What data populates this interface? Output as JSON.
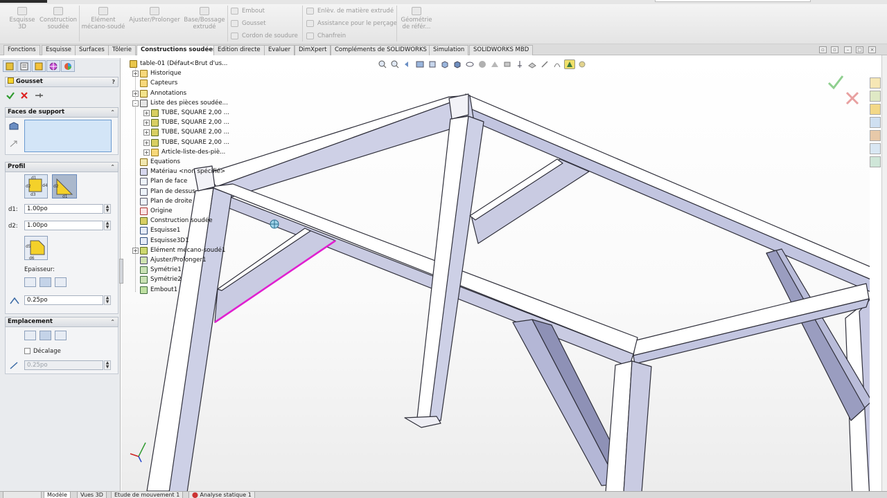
{
  "ribbon": {
    "buttons": [
      {
        "label": "Esquisse\n3D"
      },
      {
        "label": "Construction\nsoudée"
      },
      {
        "label": "Elément\nmécano-soudé"
      },
      {
        "label": "Ajuster/Prolonger"
      },
      {
        "label": "Base/Bossage\nextrudé"
      }
    ],
    "small": [
      "Embout",
      "Gousset",
      "Cordon de soudure",
      "Enlèv. de matière extrudé",
      "Assistance pour le perçage",
      "Chanfrein",
      "Géométrie\nde référ..."
    ]
  },
  "tabs": [
    "Fonctions",
    "Esquisse",
    "Surfaces",
    "Tôlerie",
    "Constructions soudées",
    "Edition directe",
    "Evaluer",
    "DimXpert",
    "Compléments de SOLIDWORKS",
    "Simulation",
    "SOLIDWORKS MBD"
  ],
  "active_tab": "Constructions soudées",
  "panel": {
    "title": "Gousset",
    "help": "?",
    "faces_header": "Faces de support",
    "profile_header": "Profil",
    "d1_label": "d1:",
    "d1_value": "1.00po",
    "d2_label": "d2:",
    "d2_value": "1.00po",
    "thickness_label": "Epaisseur:",
    "thickness_value": "0.25po",
    "location_header": "Emplacement",
    "offset_label": "Décalage",
    "offset_value": "0.25po",
    "ok_icon": "check-icon",
    "cancel_icon": "x-icon",
    "pin_icon": "pushpin-icon"
  },
  "tree": {
    "root": "table-01  (Défaut<Brut d'us...",
    "items": [
      {
        "label": "Historique",
        "expand": "+",
        "icon": "folder"
      },
      {
        "label": "Capteurs",
        "expand": "",
        "icon": "folder"
      },
      {
        "label": "Annotations",
        "expand": "+",
        "icon": "annotation"
      },
      {
        "label": "Liste des pièces soudée...",
        "expand": "-",
        "icon": "cutlist"
      },
      {
        "label": "TUBE, SQUARE 2,00 ...",
        "expand": "+",
        "icon": "weld",
        "indent": 1
      },
      {
        "label": "TUBE, SQUARE 2,00 ...",
        "expand": "+",
        "icon": "weld",
        "indent": 1
      },
      {
        "label": "TUBE, SQUARE 2,00 ...",
        "expand": "+",
        "icon": "weld",
        "indent": 1
      },
      {
        "label": "TUBE, SQUARE 2,00 ...",
        "expand": "+",
        "icon": "weld",
        "indent": 1
      },
      {
        "label": "Article-liste-des-piè...",
        "expand": "+",
        "icon": "folder",
        "indent": 1
      },
      {
        "label": "Equations",
        "expand": "",
        "icon": "equation"
      },
      {
        "label": "Matériau <non spécifié>",
        "expand": "",
        "icon": "material"
      },
      {
        "label": "Plan de face",
        "expand": "",
        "icon": "plane"
      },
      {
        "label": "Plan de dessus",
        "expand": "",
        "icon": "plane"
      },
      {
        "label": "Plan de droite",
        "expand": "",
        "icon": "plane"
      },
      {
        "label": "Origine",
        "expand": "",
        "icon": "origin"
      },
      {
        "label": "Construction soudée",
        "expand": "",
        "icon": "weld"
      },
      {
        "label": "Esquisse1",
        "expand": "",
        "icon": "sketch"
      },
      {
        "label": "Esquisse3D1",
        "expand": "",
        "icon": "sketch"
      },
      {
        "label": "Elément mécano-soudé1",
        "expand": "+",
        "icon": "member"
      },
      {
        "label": "Ajuster/Prolonger1",
        "expand": "",
        "icon": "trim"
      },
      {
        "label": "Symétrie1",
        "expand": "",
        "icon": "mirror"
      },
      {
        "label": "Symétrie2",
        "expand": "",
        "icon": "mirror"
      },
      {
        "label": "Embout1",
        "expand": "",
        "icon": "endcap"
      }
    ]
  },
  "bottom_tabs": [
    "Modèle",
    "Vues 3D",
    "Etude de mouvement 1",
    "Analyse statique 1"
  ],
  "colors": {
    "accent": "#4a7fc1",
    "highlight_edge": "#e020d0",
    "frame_face": "#c9cbe2"
  }
}
